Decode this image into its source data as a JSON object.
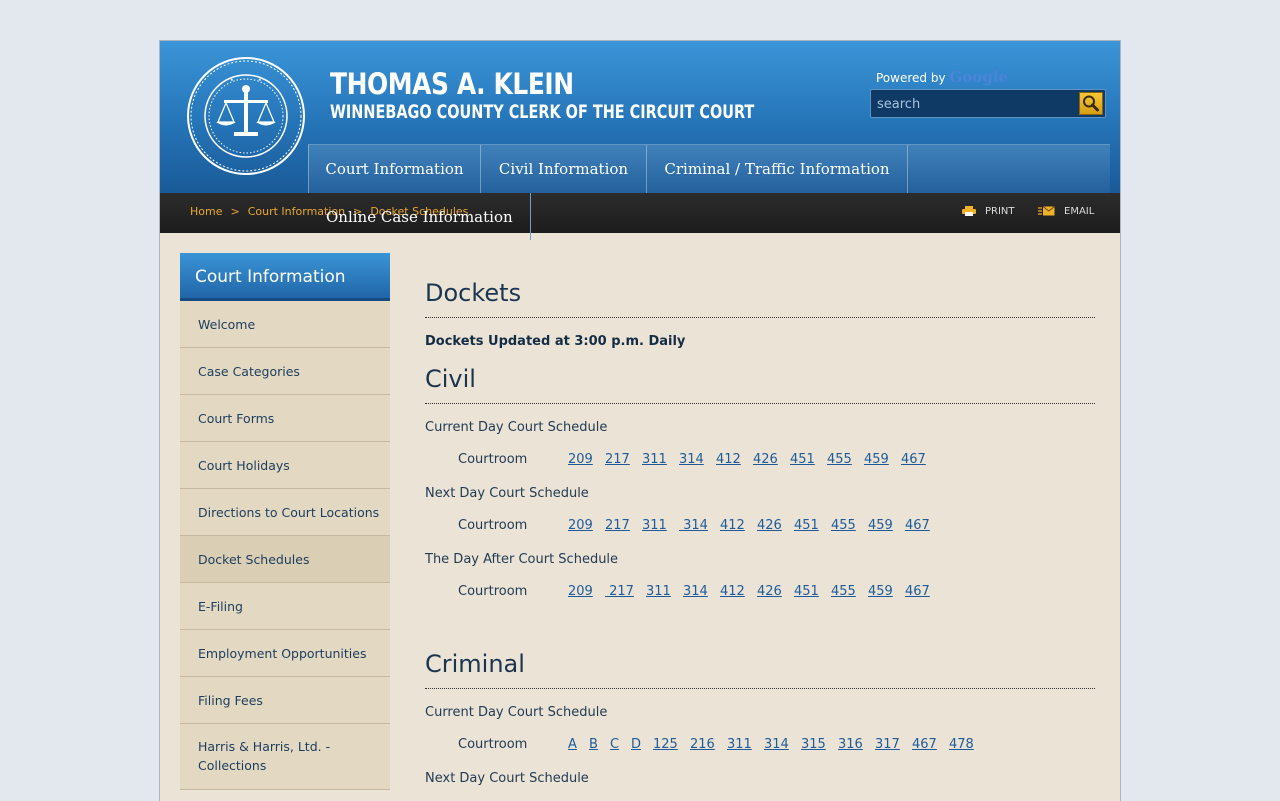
{
  "header": {
    "name": "THOMAS A. KLEIN",
    "office": "WINNEBAGO COUNTY CLERK OF THE CIRCUIT COURT",
    "seal": {
      "top": "CIRCUIT COURT",
      "rim": "WINNEBAGO COUNTY ILLINOIS 17TH JUDICIAL CIRCUIT"
    },
    "powered_by": "Powered by",
    "powered_brand": "Google",
    "search_placeholder": "search"
  },
  "nav": {
    "items": [
      "Court Information",
      "Civil Information",
      "Criminal / Traffic Information"
    ],
    "dropdown_item": "Online Case Information"
  },
  "breadcrumb": {
    "items": [
      "Home",
      "Court Information",
      "Docket Schedules"
    ],
    "separator": ">"
  },
  "tools": {
    "print": "PRINT",
    "email": "EMAIL"
  },
  "sidebar": {
    "title": "Court Information",
    "items": [
      "Welcome",
      "Case Categories",
      "Court Forms",
      "Court Holidays",
      "Directions to Court Locations",
      "Docket Schedules",
      "E-Filing",
      "Employment Opportunities",
      "Filing Fees",
      "Harris & Harris, Ltd. - Collections"
    ],
    "active": "Docket Schedules"
  },
  "main": {
    "title": "Dockets",
    "updated": "Dockets Updated at 3:00 p.m. Daily",
    "civil": {
      "heading": "Civil",
      "schedules": [
        {
          "label": "Current Day Court Schedule",
          "row_label": "Courtroom",
          "rooms": [
            "209",
            "217",
            "311",
            "314",
            "412",
            "426",
            "451",
            "455",
            "459",
            "467"
          ]
        },
        {
          "label": "Next Day Court Schedule",
          "row_label": "Courtroom",
          "rooms": [
            "209",
            "217",
            "311",
            " 314",
            "412",
            "426",
            "451",
            "455",
            "459",
            "467"
          ]
        },
        {
          "label": "The Day After Court Schedule",
          "row_label": "Courtroom",
          "rooms": [
            "209",
            " 217",
            "311",
            "314",
            "412",
            "426",
            "451",
            "455",
            "459",
            "467"
          ]
        }
      ]
    },
    "criminal": {
      "heading": "Criminal",
      "schedules": [
        {
          "label": "Current Day Court Schedule",
          "row_label": "Courtroom",
          "rooms": [
            "A",
            "B",
            "C",
            "D",
            "125",
            "216",
            "311",
            "314",
            "315",
            "316",
            "317",
            "467",
            "478"
          ]
        },
        {
          "label": "Next Day Court Schedule"
        }
      ]
    }
  },
  "colors": {
    "header_blue": "#2574b8",
    "link": "#1f5b9a",
    "crumb_accent": "#e8a832",
    "page_bg": "#ebe3d5"
  }
}
